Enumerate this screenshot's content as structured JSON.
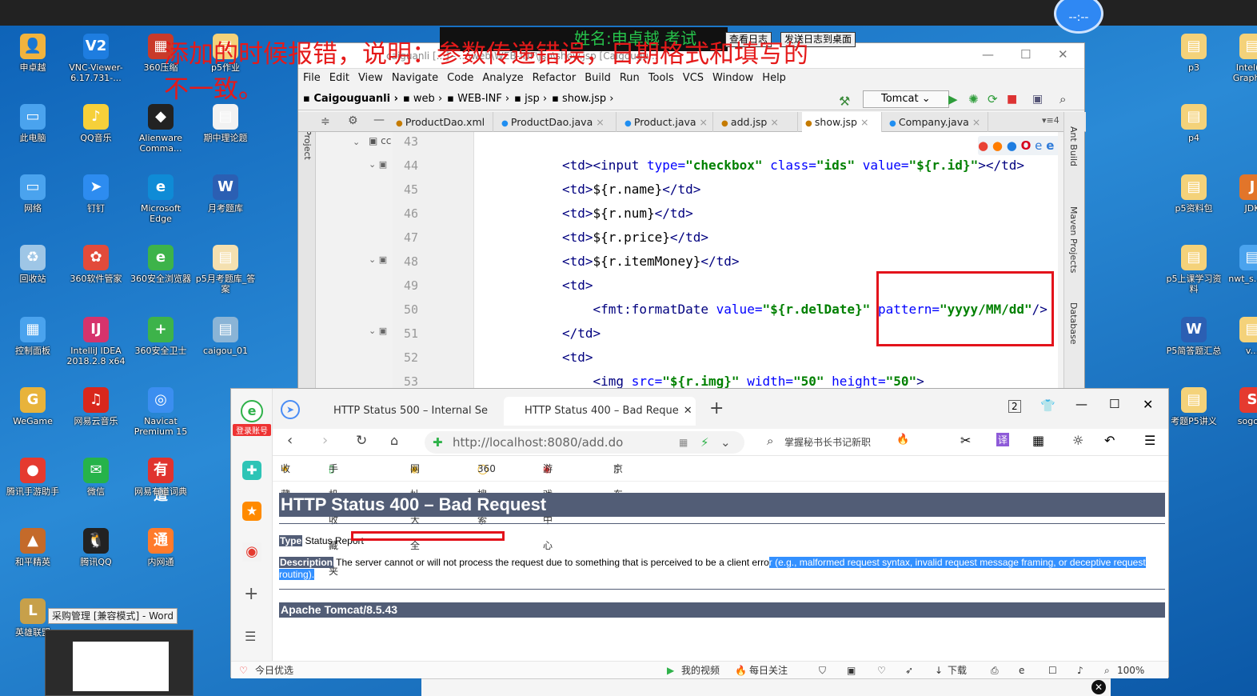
{
  "overlay_note": {
    "text": "添加的时候报错，说明：参数传递错误，日期格式和填写的不一致。",
    "log_name": "姓名:申卓越 考试",
    "btn_view_log": "查看日志",
    "btn_send_log": "发送日志到桌面",
    "clock": "--:--"
  },
  "desktop_icons_left": [
    {
      "label": "申卓越",
      "glyph": "👤",
      "color": "#f2b33d"
    },
    {
      "label": "VNC-Viewer-6.17.731-...",
      "glyph": "V2",
      "color": "#1e7de0"
    },
    {
      "label": "360压缩",
      "glyph": "▦",
      "color": "#c93a2a"
    },
    {
      "label": "p5作业",
      "glyph": "▤",
      "color": "#f4d27a"
    },
    {
      "label": "此电脑",
      "glyph": "▭",
      "color": "#4aa3ee"
    },
    {
      "label": "QQ音乐",
      "glyph": "♪",
      "color": "#f6d03a"
    },
    {
      "label": "Alienware Comma...",
      "glyph": "◆",
      "color": "#222"
    },
    {
      "label": "期中理论题",
      "glyph": "▤",
      "color": "#f2f2f2"
    },
    {
      "label": "网络",
      "glyph": "▭",
      "color": "#4aa3ee"
    },
    {
      "label": "钉钉",
      "glyph": "➤",
      "color": "#2d8cf0"
    },
    {
      "label": "Microsoft Edge",
      "glyph": "e",
      "color": "#0f8bd6"
    },
    {
      "label": "月考题库",
      "glyph": "W",
      "color": "#2b5fb3"
    },
    {
      "label": "回收站",
      "glyph": "♻",
      "color": "#9ec6e6"
    },
    {
      "label": "360软件管家",
      "glyph": "✿",
      "color": "#e24b3b"
    },
    {
      "label": "360安全浏览器",
      "glyph": "e",
      "color": "#3db34a"
    },
    {
      "label": "p5月考题库_答案",
      "glyph": "▤",
      "color": "#f4e0b0"
    },
    {
      "label": "控制面板",
      "glyph": "▦",
      "color": "#4aa3ee"
    },
    {
      "label": "IntelliJ IDEA 2018.2.8 x64",
      "glyph": "IJ",
      "color": "#d6336c"
    },
    {
      "label": "360安全卫士",
      "glyph": "+",
      "color": "#3db34a"
    },
    {
      "label": "caigou_01",
      "glyph": "▤",
      "color": "#8ab4d6"
    },
    {
      "label": "WeGame",
      "glyph": "G",
      "color": "#e8b33b"
    },
    {
      "label": "网易云音乐",
      "glyph": "♫",
      "color": "#d9271c"
    },
    {
      "label": "Navicat Premium 15",
      "glyph": "◎",
      "color": "#3b8ef0"
    },
    {
      "label": "腾讯手游助手",
      "glyph": "●",
      "color": "#e53a2f"
    },
    {
      "label": "微信",
      "glyph": "✉",
      "color": "#26b34a"
    },
    {
      "label": "网易有道词典",
      "glyph": "有道",
      "color": "#e0332f"
    },
    {
      "label": "和平精英",
      "glyph": "▲",
      "color": "#c46a2a"
    },
    {
      "label": "腾讯QQ",
      "glyph": "🐧",
      "color": "#222"
    },
    {
      "label": "内网通",
      "glyph": "通",
      "color": "#ff7b2c"
    },
    {
      "label": "英雄联盟",
      "glyph": "L",
      "color": "#c7a04a"
    }
  ],
  "desktop_icons_right": [
    {
      "label": "p3",
      "glyph": "▤",
      "color": "#f4d27a"
    },
    {
      "label": "Intel(R) Graphics",
      "glyph": "▤",
      "color": "#f4d27a"
    },
    {
      "label": "p4",
      "glyph": "▤",
      "color": "#f4d27a"
    },
    {
      "label": "p5资料包",
      "glyph": "▤",
      "color": "#f4d27a"
    },
    {
      "label": "JDK",
      "glyph": "J",
      "color": "#e2752a"
    },
    {
      "label": "p5上课学习资料",
      "glyph": "▤",
      "color": "#f4d27a"
    },
    {
      "label": "nwt_s...4.1",
      "glyph": "▤",
      "color": "#4aa3ee"
    },
    {
      "label": "P5简答题汇总",
      "glyph": "W",
      "color": "#2b5fb3"
    },
    {
      "label": "v...",
      "glyph": "▤",
      "color": "#f4d27a"
    },
    {
      "label": "考题P5讲义",
      "glyph": "▤",
      "color": "#f4d27a"
    },
    {
      "label": "sogo...",
      "glyph": "S",
      "color": "#e53a2f"
    }
  ],
  "ide": {
    "title": "caiguanli [...] - ...\\web\\WEB-INF\\jsp\\show.jsp [Caigougu...",
    "menu": [
      "File",
      "Edit",
      "View",
      "Navigate",
      "Code",
      "Analyze",
      "Refactor",
      "Build",
      "Run",
      "Tools",
      "VCS",
      "Window",
      "Help"
    ],
    "breadcrumbs": [
      "Caigouguanli",
      "web",
      "WEB-INF",
      "jsp",
      "show.jsp"
    ],
    "run_config": "Tomcat",
    "tabs": [
      "ProductDao.xml",
      "ProductDao.java",
      "Product.java",
      "add.jsp",
      "show.jsp",
      "Company.java"
    ],
    "active_tab": "show.jsp",
    "project_panel_label": "1: Project",
    "right_tools": [
      "Ant Build",
      "Maven Projects",
      "Database"
    ],
    "code_lines": [
      {
        "num": "43",
        "segments": [
          {
            "c": "tg",
            "t": ""
          }
        ]
      },
      {
        "num": "44",
        "segments": [
          {
            "c": "tg",
            "t": "<td><input "
          },
          {
            "c": "at",
            "t": "type="
          },
          {
            "c": "st",
            "t": "\"checkbox\" "
          },
          {
            "c": "at",
            "t": "class="
          },
          {
            "c": "st",
            "t": "\"ids\" "
          },
          {
            "c": "at",
            "t": "value="
          },
          {
            "c": "st",
            "t": "\"${r.id}\""
          },
          {
            "c": "tg",
            "t": "></td>"
          }
        ]
      },
      {
        "num": "45",
        "segments": [
          {
            "c": "tg",
            "t": "<td>"
          },
          {
            "c": "pl",
            "t": "${r.name}"
          },
          {
            "c": "tg",
            "t": "</td>"
          }
        ]
      },
      {
        "num": "46",
        "segments": [
          {
            "c": "tg",
            "t": "<td>"
          },
          {
            "c": "pl",
            "t": "${r.num}"
          },
          {
            "c": "tg",
            "t": "</td>"
          }
        ]
      },
      {
        "num": "47",
        "segments": [
          {
            "c": "tg",
            "t": "<td>"
          },
          {
            "c": "pl",
            "t": "${r.price}"
          },
          {
            "c": "tg",
            "t": "</td>"
          }
        ]
      },
      {
        "num": "48",
        "segments": [
          {
            "c": "tg",
            "t": "<td>"
          },
          {
            "c": "pl",
            "t": "${r.itemMoney}"
          },
          {
            "c": "tg",
            "t": "</td>"
          }
        ]
      },
      {
        "num": "49",
        "segments": [
          {
            "c": "tg",
            "t": "<td>"
          }
        ]
      },
      {
        "num": "50",
        "segments": [
          {
            "c": "tg",
            "t": "    <fmt:formatDate "
          },
          {
            "c": "at",
            "t": "value="
          },
          {
            "c": "st",
            "t": "\"${r.delDate}\" "
          },
          {
            "c": "at",
            "t": "pattern="
          },
          {
            "c": "st",
            "t": "\"yyyy/MM/dd\""
          },
          {
            "c": "tg",
            "t": "/>"
          }
        ]
      },
      {
        "num": "51",
        "segments": [
          {
            "c": "tg",
            "t": "</td>"
          }
        ]
      },
      {
        "num": "52",
        "segments": [
          {
            "c": "tg",
            "t": "<td>"
          }
        ]
      },
      {
        "num": "53",
        "segments": [
          {
            "c": "tg",
            "t": "    <img "
          },
          {
            "c": "at",
            "t": "src="
          },
          {
            "c": "st",
            "t": "\"${r.img}\" "
          },
          {
            "c": "at",
            "t": "width="
          },
          {
            "c": "st",
            "t": "\"50\" "
          },
          {
            "c": "at",
            "t": "height="
          },
          {
            "c": "st",
            "t": "\"50\""
          },
          {
            "c": "tg",
            "t": ">"
          }
        ]
      }
    ]
  },
  "browser": {
    "side_label": "登录账号",
    "tabs": [
      "HTTP Status 500 – Internal Se",
      "HTTP Status 400 – Bad Reque"
    ],
    "url": "http://localhost:8080/add.do",
    "search_hint": "掌握秘书长书记新职",
    "bookmarks": [
      "收藏",
      "手机收藏夹",
      "网址大全",
      "360搜索",
      "游戏中心",
      "京东"
    ],
    "page": {
      "title": "HTTP Status 400 – Bad Request",
      "type_label": "Type",
      "type_value": "Status Report",
      "desc_label": "Description",
      "desc_text": "The server cannot or will not process the request due to something that is perceived to be a client erro",
      "desc_selected": "r (e.g., malformed request syntax, invalid request message framing, or deceptive request routing).",
      "footer": "Apache Tomcat/8.5.43"
    },
    "status_left": "今日优选",
    "status_items": [
      "我的视频",
      "每日关注",
      "下载"
    ],
    "zoom": "100%"
  },
  "taskbar": {
    "word_tooltip": "采购管理 [兼容模式] - Word"
  },
  "colors": {
    "annotation_red": "#e3131b",
    "tomcat_header": "#525d76",
    "selection": "#3390ff"
  }
}
